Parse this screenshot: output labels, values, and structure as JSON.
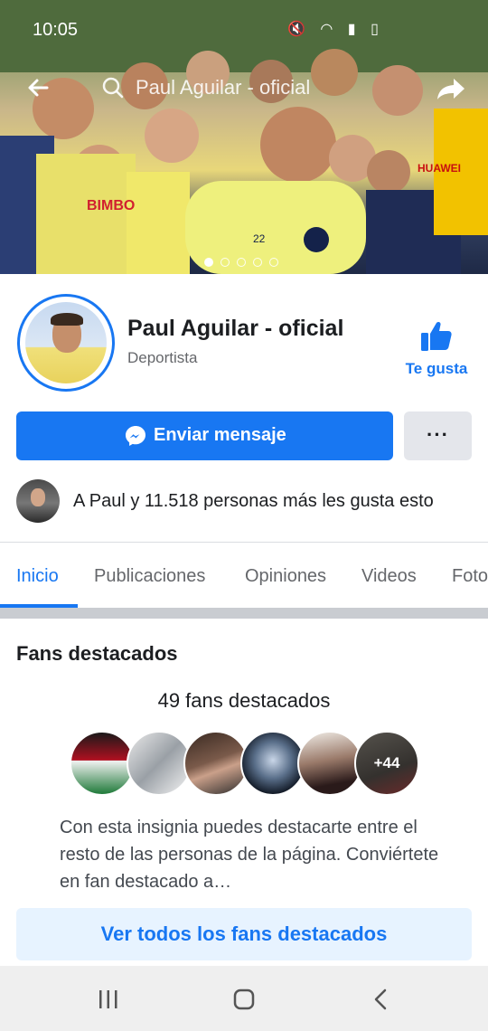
{
  "status_bar": {
    "time": "10:05",
    "icons": [
      "image-icon",
      "mute-icon",
      "wifi-icon",
      "volte-icon",
      "signal-icon",
      "battery-icon"
    ]
  },
  "header": {
    "search_text": "Paul Aguilar - oficial"
  },
  "cover": {
    "carousel_dots": 5,
    "active_dot": 0
  },
  "profile": {
    "name": "Paul Aguilar - oficial",
    "category": "Deportista",
    "like_label": "Te gusta"
  },
  "actions": {
    "message_label": "Enviar mensaje",
    "more_label": "···"
  },
  "likes_summary": "A Paul y 11.518 personas más les gusta esto",
  "tabs": [
    {
      "label": "Inicio",
      "active": true
    },
    {
      "label": "Publicaciones",
      "active": false
    },
    {
      "label": "Opiniones",
      "active": false
    },
    {
      "label": "Videos",
      "active": false
    },
    {
      "label": "Foto",
      "active": false
    }
  ],
  "fans": {
    "title": "Fans destacados",
    "count_text": "49 fans destacados",
    "more_badge": "+44",
    "description": "Con esta insignia puedes destacarte entre el resto de las personas de la página. Conviértete en fan destacado a…",
    "see_all_label": "Ver todos los fans destacados"
  },
  "colors": {
    "accent": "#1877f2",
    "accent_light": "#e7f3ff",
    "secondary_button": "#e4e6eb",
    "nav_bar": "#efefef"
  }
}
